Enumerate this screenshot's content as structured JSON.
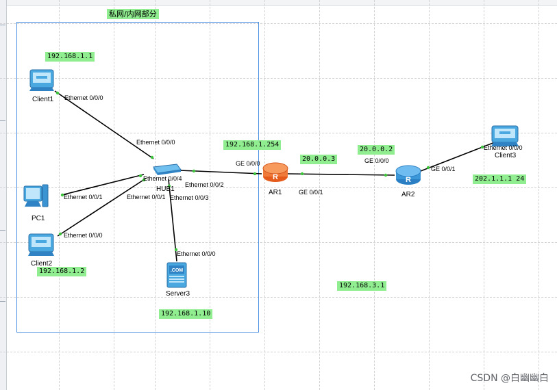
{
  "zone": {
    "title": "私网/内网部分"
  },
  "devices": {
    "client1": {
      "name": "Client1",
      "icon": "client-icon"
    },
    "pc1": {
      "name": "PC1",
      "icon": "pc-icon"
    },
    "client2": {
      "name": "Client2",
      "icon": "client-icon"
    },
    "hub1": {
      "name": "HUB1",
      "icon": "hub-icon"
    },
    "server3": {
      "name": "Server3",
      "icon": "server-icon",
      "badge": ".COM"
    },
    "ar1": {
      "name": "AR1",
      "icon": "router-icon",
      "badge": "R"
    },
    "ar2": {
      "name": "AR2",
      "icon": "router-icon",
      "badge": "R"
    },
    "client3": {
      "name": "Client3",
      "icon": "client-icon"
    }
  },
  "ips": {
    "client1": "192.168.1.1",
    "client2": "192.168.1.2",
    "server3": "192.168.1.10",
    "ar1_lan": "192.168.1.254",
    "ar1_wan": "20.0.0.3",
    "ar2_wan": "20.0.0.2",
    "client3": "202.1.1.1 24",
    "extra": "192.168.3.1"
  },
  "ports": {
    "client1_eth": "Ethernet 0/0/0",
    "hub_to_client1": "Ethernet 0/0/0",
    "hub_to_ar1": "Ethernet 0/0/4",
    "hub_to_pc1": "Ethernet 0/0/1",
    "hub_to_server3": "Ethernet 0/0/3",
    "hub_eth2": "Ethernet 0/0/2",
    "pc1_eth": "Ethernet 0/0/1",
    "client2_eth": "Ethernet 0/0/0",
    "server3_eth": "Ethernet 0/0/0",
    "ar1_ge000": "GE 0/0/0",
    "ar1_ge001": "GE 0/0/1",
    "ar2_ge000": "GE 0/0/0",
    "ar2_ge001": "GE 0/0/1",
    "client3_eth": "Ethernet 0/0/0"
  },
  "watermark": "CSDN @白幽幽白",
  "colors": {
    "ip_bg": "#90ee90",
    "zone_border": "#4a90e2",
    "link": "#000000",
    "endpoint": "#3cc43c"
  }
}
